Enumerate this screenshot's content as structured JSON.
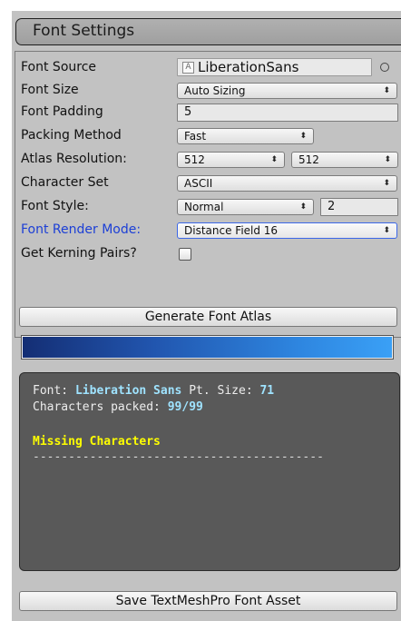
{
  "header": {
    "title": "Font Settings"
  },
  "fields": {
    "font_source": {
      "label": "Font Source",
      "value": "LiberationSans"
    },
    "font_size": {
      "label": "Font Size",
      "value": "Auto Sizing"
    },
    "font_padding": {
      "label": "Font Padding",
      "value": "5"
    },
    "packing_method": {
      "label": "Packing Method",
      "value": "Fast"
    },
    "atlas_resolution": {
      "label": "Atlas Resolution:",
      "width": "512",
      "height": "512"
    },
    "character_set": {
      "label": "Character Set",
      "value": "ASCII"
    },
    "font_style": {
      "label": "Font Style:",
      "value": "Normal",
      "modifier": "2"
    },
    "font_render_mode": {
      "label": "Font Render Mode:",
      "value": "Distance Field 16"
    },
    "kerning": {
      "label": "Get Kerning Pairs?",
      "checked": false
    }
  },
  "buttons": {
    "generate": "Generate Font Atlas",
    "save": "Save TextMeshPro Font Asset"
  },
  "progress": {
    "fraction": 1.0
  },
  "info": {
    "font_label": "Font:",
    "font_name": "Liberation Sans",
    "pt_label": "Pt. Size:",
    "pt_value": "71",
    "packed_label": "Characters packed:",
    "packed_value": "99/99",
    "missing_title": "Missing Characters",
    "divider": "-----------------------------------------"
  },
  "colors": {
    "panel_bg": "#c2c2c2",
    "active_label": "#1c3fd6",
    "info_highlight": "#9fe3ff",
    "missing_color": "#ffff00",
    "progress_start": "#142e74",
    "progress_end": "#3aa0f6"
  }
}
